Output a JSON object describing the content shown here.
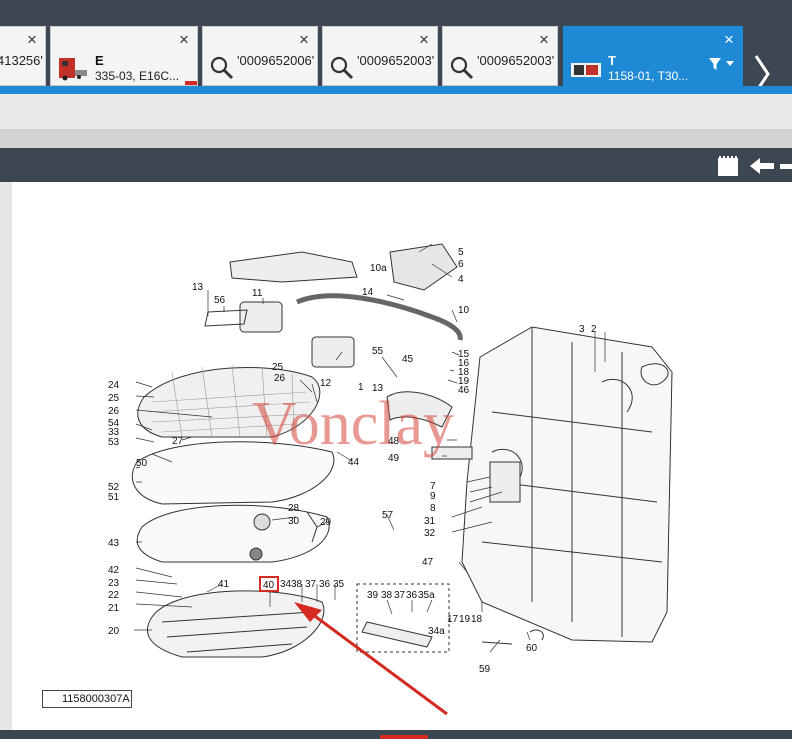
{
  "tabs": [
    {
      "label": "413256'",
      "type": "text"
    },
    {
      "title": "E",
      "subtitle": "335-03, E16C...",
      "type": "thumb"
    },
    {
      "label": "'0009652006'",
      "type": "search"
    },
    {
      "label": "'0009652003'",
      "type": "search"
    },
    {
      "label": "'0009652003'",
      "type": "search"
    },
    {
      "title": "T",
      "subtitle": "1158-01, T30...",
      "type": "thumb"
    }
  ],
  "close_glyph": "×",
  "diagram": {
    "reference": "1158000307A",
    "watermark": "Vonclay",
    "callouts": {
      "c5": "5",
      "c6": "6",
      "c10a": "10a",
      "c4": "4",
      "c14": "14",
      "c10": "10",
      "c13a": "13",
      "c56": "56",
      "c11": "11",
      "c3": "3",
      "c2": "2",
      "c15": "15",
      "c16": "16",
      "c18": "18",
      "c19": "19",
      "c46": "46",
      "c45": "45",
      "c55": "55",
      "c12": "12",
      "c1": "1",
      "c13b": "13",
      "c25a": "25",
      "c26a": "26",
      "c24": "24",
      "c25b": "25",
      "c26b": "26",
      "c54": "54",
      "c33": "33",
      "c53": "53",
      "c27": "27",
      "c50": "50",
      "c52": "52",
      "c51": "51",
      "c44": "44",
      "c48": "48",
      "c49": "49",
      "c7": "7",
      "c9": "9",
      "c8": "8",
      "c31": "31",
      "c32": "32",
      "c43": "43",
      "c30": "30",
      "c29": "29",
      "c28": "28",
      "c57": "57",
      "c47": "47",
      "c42": "42",
      "c23": "23",
      "c22": "22",
      "c21": "21",
      "c41": "41",
      "c40": "40",
      "c34": "34",
      "c38a": "38",
      "c37a": "37",
      "c36a": "36",
      "c35": "35",
      "c39": "39",
      "c38b": "38",
      "c37b": "37",
      "c36b": "36",
      "c35a": "35a",
      "c34a": "34a",
      "c17": "17",
      "c19b": "19",
      "c18b": "18",
      "c20": "20",
      "c59": "59",
      "c60": "60"
    }
  },
  "colors": {
    "accent": "#1e8ad6",
    "dark": "#3d4752",
    "highlight": "#d42a20"
  }
}
